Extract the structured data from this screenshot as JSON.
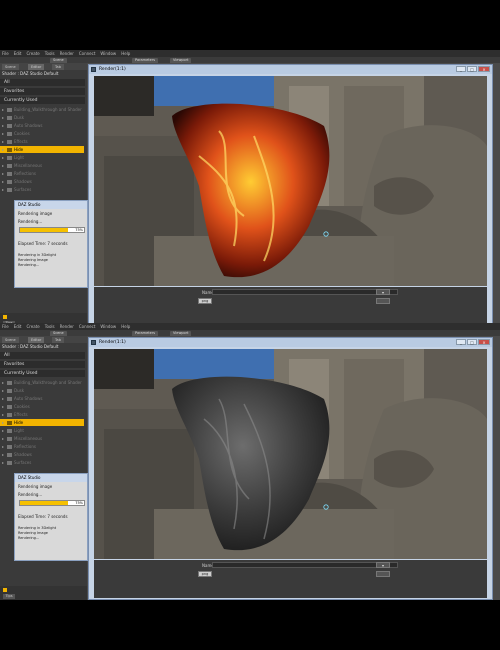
{
  "app": {
    "menu": [
      "File",
      "Edit",
      "Create",
      "Tools",
      "Render",
      "Connect",
      "Window",
      "Help"
    ],
    "top_tabs": [
      "Scene",
      "Parameters",
      "Viewport"
    ]
  },
  "library": {
    "tabs": [
      "Scene",
      "Editor",
      "Tab"
    ],
    "title": "Shader : DAZ Studio Default",
    "categories": [
      "All",
      "Favorites",
      "Currently Used"
    ],
    "tree_items": [
      "Building_Walkthrough and Shader",
      "Dusk",
      "Auto Shadows",
      "Cookies",
      "Effects",
      "Hide",
      "Light",
      "Miscellaneous",
      "Reflections",
      "Shadows",
      "Surfaces"
    ],
    "selected_item": "Hide"
  },
  "progress": {
    "title": "DAZ Studio",
    "status": "Rendering image",
    "phase": "Rendering...",
    "percent_label": "75%",
    "percent_value": 75,
    "elapsed_top": "Elapsed Time: 7 seconds",
    "elapsed_bottom": "Elapsed Time: 7 seconds",
    "log": [
      "Rendering in 3Delight",
      "Rendering Image",
      "Rendering..."
    ]
  },
  "render_window": {
    "title": "Render(1:1)",
    "name_label": "Name",
    "format_value": "png"
  },
  "colors": {
    "accent": "#f2b400",
    "window_chrome": "#c6d4e6",
    "panel": "#3a3a3a"
  }
}
